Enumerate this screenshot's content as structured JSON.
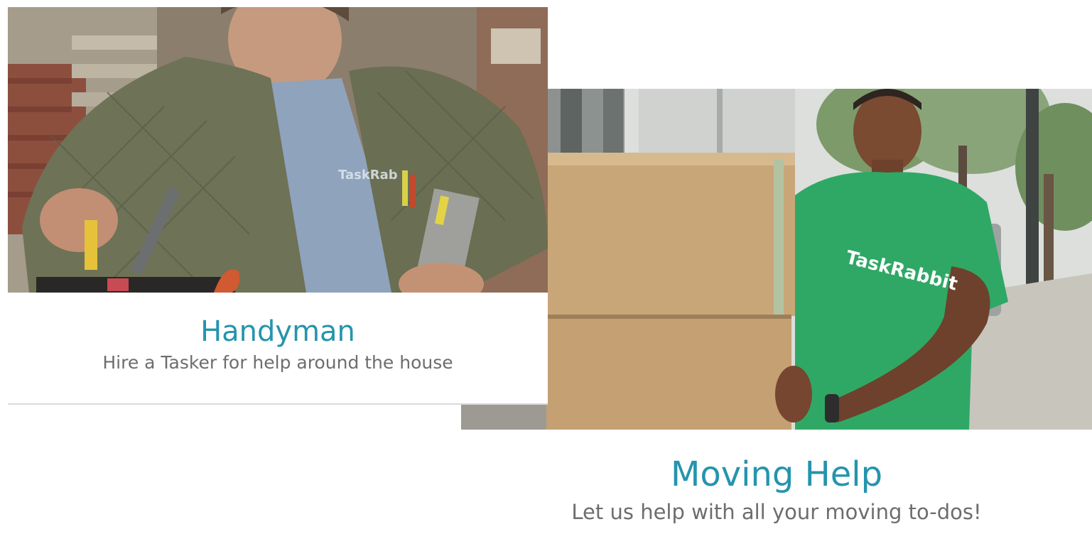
{
  "cards": [
    {
      "title": "Handyman",
      "subtitle": "Hire a Tasker for help around the house",
      "photo": {
        "logo_text": "TaskRab"
      }
    },
    {
      "title": "Moving Help",
      "subtitle": "Let us help with all your moving to-dos!",
      "photo": {
        "logo_text": "TaskRabbit"
      }
    }
  ],
  "colors": {
    "title": "#2594ad",
    "subtitle": "#6d6d6d",
    "shirt_green": "#2fa865",
    "jacket_olive": "#6e7256",
    "box_cardboard": "#c9a678"
  }
}
